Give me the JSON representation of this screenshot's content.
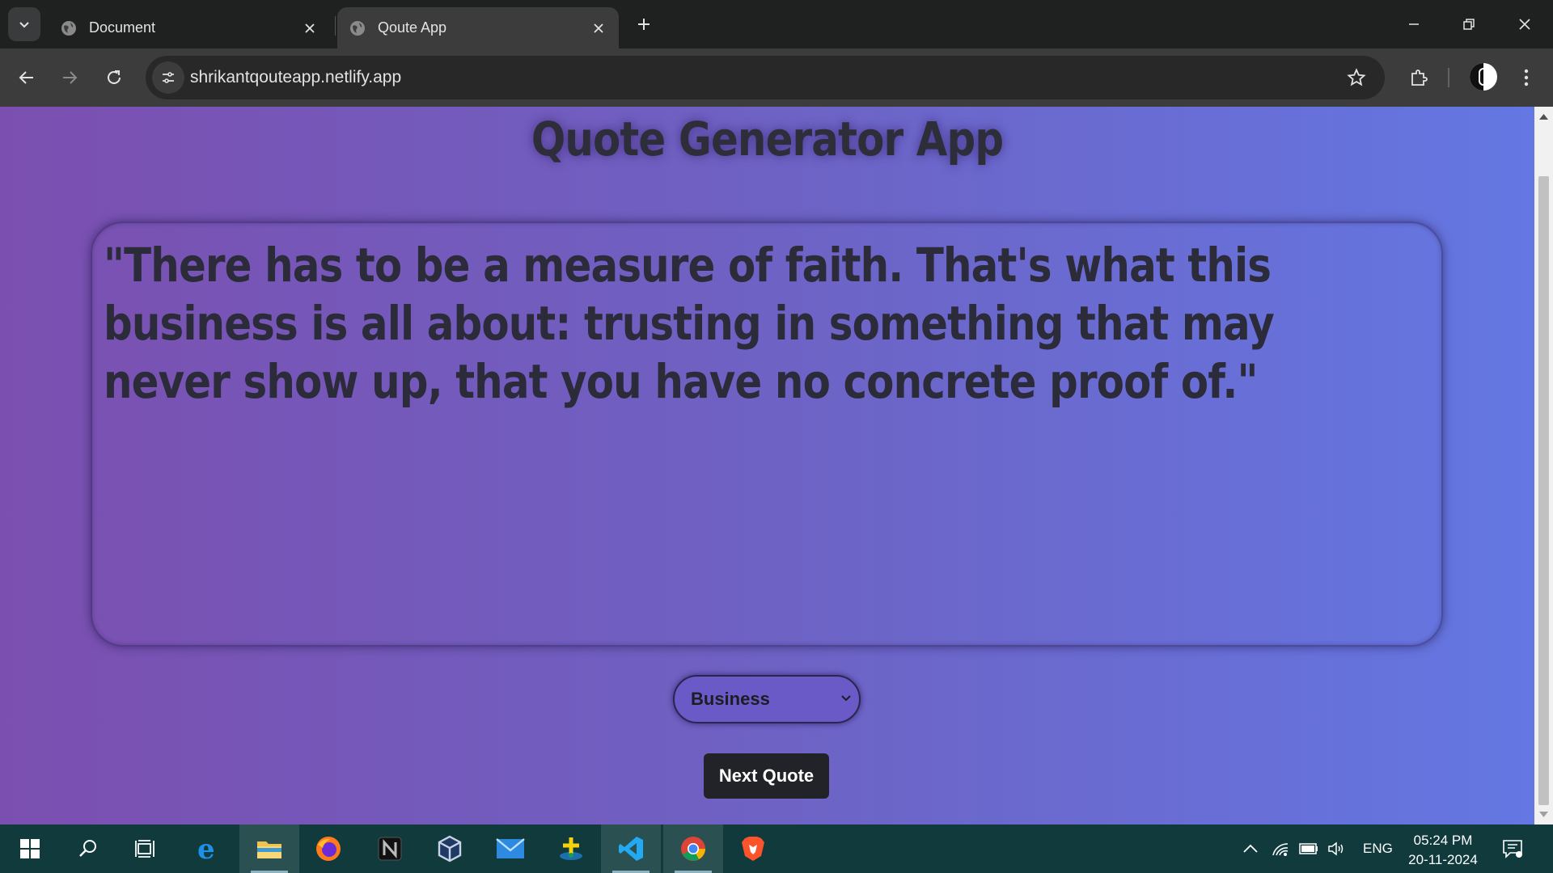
{
  "browser": {
    "tabs": [
      {
        "title": "Document",
        "active": false
      },
      {
        "title": "Qoute App",
        "active": true
      }
    ],
    "url": "shrikantqouteapp.netlify.app"
  },
  "page": {
    "title": "Quote Generator App",
    "quote": "\"There has to be a measure of faith. That's what this business is all about: trusting in something that may never show up, that you have no concrete proof of.\"",
    "category_select": {
      "selected": "Business"
    },
    "next_button": "Next Quote",
    "colors": {
      "gradient_start": "#7b4fb0",
      "gradient_end": "#6477e2",
      "button_bg": "#222328"
    }
  },
  "taskbar": {
    "apps": [
      "start-icon",
      "search-icon",
      "task-view-icon",
      "edge-icon",
      "file-explorer-icon",
      "firefox-icon",
      "notion-icon",
      "virtualbox-icon",
      "mail-icon",
      "app-icon",
      "vscode-icon",
      "chrome-icon",
      "brave-icon"
    ],
    "language": "ENG",
    "time": "05:24 PM",
    "date": "20-11-2024"
  }
}
